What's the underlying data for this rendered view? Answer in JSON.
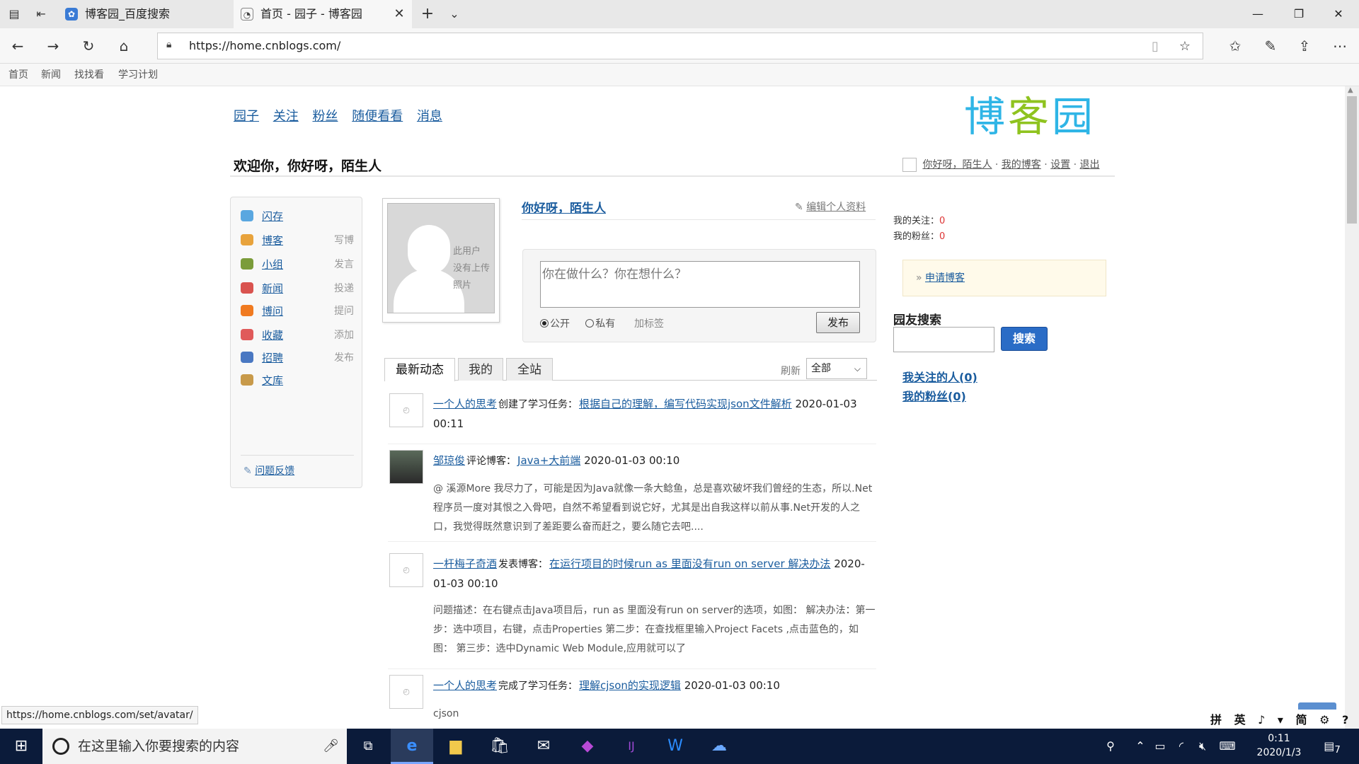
{
  "browser": {
    "tabs": [
      {
        "title": "博客园_百度搜索",
        "favicon": "baidu-paw-icon"
      },
      {
        "title": "首页 - 园子 - 博客园",
        "favicon": "cnblogs-icon"
      }
    ],
    "address": "https://home.cnblogs.com/",
    "favbar": [
      "首页",
      "新闻",
      "找找看",
      "学习计划"
    ],
    "status_url": "https://home.cnblogs.com/set/avatar/"
  },
  "site": {
    "topnav": [
      "园子",
      "关注",
      "粉丝",
      "随便看看",
      "消息"
    ],
    "logo": "博客园",
    "logo_colors": [
      "#2fb5e6",
      "#8fc31f",
      "#2fb5e6"
    ],
    "welcome": "欢迎你，你好呀，陌生人",
    "userbar": {
      "name": "你好呀，陌生人",
      "myblog": "我的博客",
      "settings": "设置",
      "logout": "退出",
      "sep": "·"
    }
  },
  "leftmenu": [
    {
      "label": "闪存",
      "action": "",
      "icon": "chat-bubble-icon",
      "color": "#5aa7e0"
    },
    {
      "label": "博客",
      "action": "写博",
      "icon": "pencil-note-icon",
      "color": "#e8a33c"
    },
    {
      "label": "小组",
      "action": "发言",
      "icon": "group-icon",
      "color": "#7b9c3a"
    },
    {
      "label": "新闻",
      "action": "投递",
      "icon": "news-icon",
      "color": "#d9534f"
    },
    {
      "label": "博问",
      "action": "提问",
      "icon": "question-icon",
      "color": "#f07a20"
    },
    {
      "label": "收藏",
      "action": "添加",
      "icon": "bookmark-icon",
      "color": "#e05a5a"
    },
    {
      "label": "招聘",
      "action": "发布",
      "icon": "job-icon",
      "color": "#4a78c2"
    },
    {
      "label": "文库",
      "action": "",
      "icon": "book-icon",
      "color": "#c89a4a"
    }
  ],
  "feedback": "问题反馈",
  "profile": {
    "name": "你好呀，陌生人",
    "edit": "编辑个人资料",
    "avatar_text": [
      "此用户",
      "没有上传",
      "照片"
    ]
  },
  "status": {
    "placeholder": "你在做什么？你在想什么？",
    "public": "公开",
    "private": "私有",
    "tag": "加标签",
    "publish": "发布"
  },
  "feed_tabs": [
    "最新动态",
    "我的",
    "全站"
  ],
  "refresh": "刷新",
  "filter": "全部",
  "feed": [
    {
      "user": "一个人的思考",
      "verb": "创建了学习任务：",
      "target": "根据自己的理解，编写代码实现json文件解析",
      "time": "2020-01-03 00:11",
      "body": ""
    },
    {
      "user": "邹琼俊",
      "verb": "评论博客：",
      "target": "Java+大前端",
      "time": "2020-01-03 00:10",
      "body": "@ 溪源More 我尽力了，可能是因为Java就像一条大鲶鱼，总是喜欢破坏我们曾经的生态，所以.Net程序员一度对其恨之入骨吧，自然不希望看到说它好，尤其是出自我这样以前从事.Net开发的人之口，我觉得既然意识到了差距要么奋而赶之，要么随它去吧...."
    },
    {
      "user": "一杆梅子奇酒",
      "verb": "发表博客：",
      "target": "在运行项目的时候run as 里面没有run on server 解决办法",
      "time": "2020-01-03 00:10",
      "body": "问题描述：在右键点击Java项目后，run as 里面没有run on server的选项，如图： 解决办法：第一步：选中项目，右键，点击Properties 第二步：在查找框里输入Project Facets ,点击蓝色的，如图： 第三步：选中Dynamic Web Module,应用就可以了"
    },
    {
      "user": "一个人的思考",
      "verb": "完成了学习任务：",
      "target": "理解cjson的实现逻辑",
      "time": "2020-01-03 00:10",
      "body": "cjson"
    }
  ],
  "right": {
    "follow_label": "我的关注：",
    "follow_count": "0",
    "fans_label": "我的粉丝：",
    "fans_count": "0",
    "apply": "申请博客",
    "search_title": "园友搜索",
    "search_btn": "搜索",
    "links": [
      "我关注的人(0)",
      "我的粉丝(0)"
    ]
  },
  "ime": "拼 英 ♪ ▾ 简 ⚙ ?",
  "taskbar": {
    "search_placeholder": "在这里输入你要搜索的内容",
    "time": "0:11",
    "date": "2020/1/3",
    "notif": "7"
  }
}
